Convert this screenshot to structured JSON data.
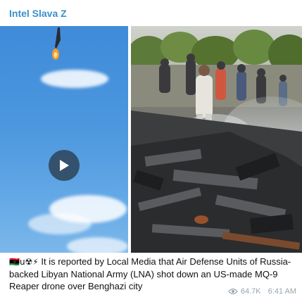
{
  "channel": {
    "name": "Intel Slava Z"
  },
  "post": {
    "emoji_prefix": "🇱🇾​u☢⚡",
    "text": "It is reported by Local Media that Air Defense Units of Russia-backed Libyan National Army (LNA) shot down an US-made MQ-9 Reaper drone over Benghazi city",
    "views": "64.7K",
    "time": "6:41 AM"
  },
  "media": {
    "video": {
      "play_icon": "play-icon"
    },
    "photo": {
      "subject": "crash-site-photo"
    }
  },
  "colors": {
    "channel_name": "#3a8fc9",
    "meta": "#9aa4ad"
  }
}
